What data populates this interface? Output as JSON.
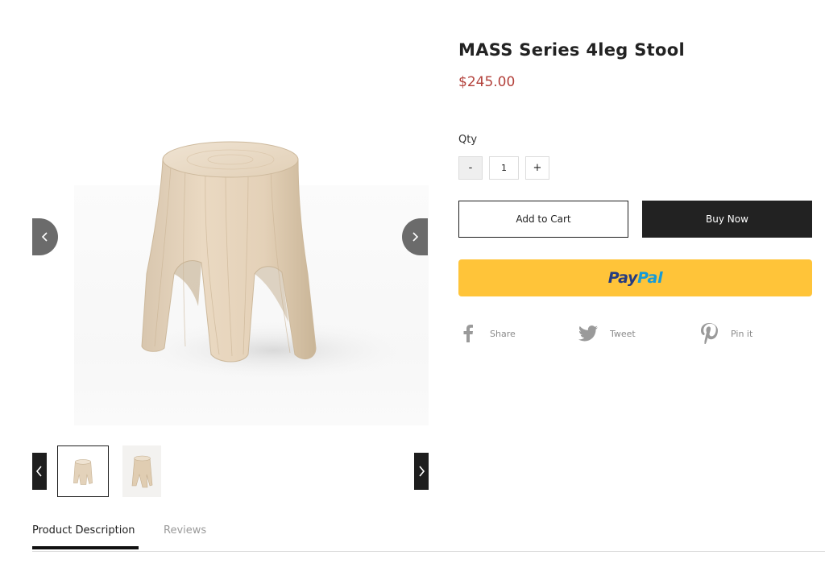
{
  "product": {
    "title": "MASS Series 4leg Stool",
    "price": "$245.00"
  },
  "gallery": {
    "main_image_alt": "Wooden four-leg stool",
    "thumbnails": [
      "stool-front-thumbnail",
      "stool-side-thumbnail"
    ],
    "selected_thumbnail": 1
  },
  "quantity": {
    "label": "Qty",
    "minus_label": "-",
    "plus_label": "+",
    "value": "1"
  },
  "actions": {
    "add_to_cart": "Add to Cart",
    "buy_now": "Buy Now",
    "paypal_pay": "Pay",
    "paypal_pal": "Pal"
  },
  "share": {
    "facebook": "Share",
    "twitter": "Tweet",
    "pinterest": "Pin it"
  },
  "tabs": {
    "description": "Product Description",
    "reviews": "Reviews"
  },
  "colors": {
    "price": "#b3413b",
    "paypal_button": "#ffc439",
    "buy_now_bg": "#222222"
  }
}
